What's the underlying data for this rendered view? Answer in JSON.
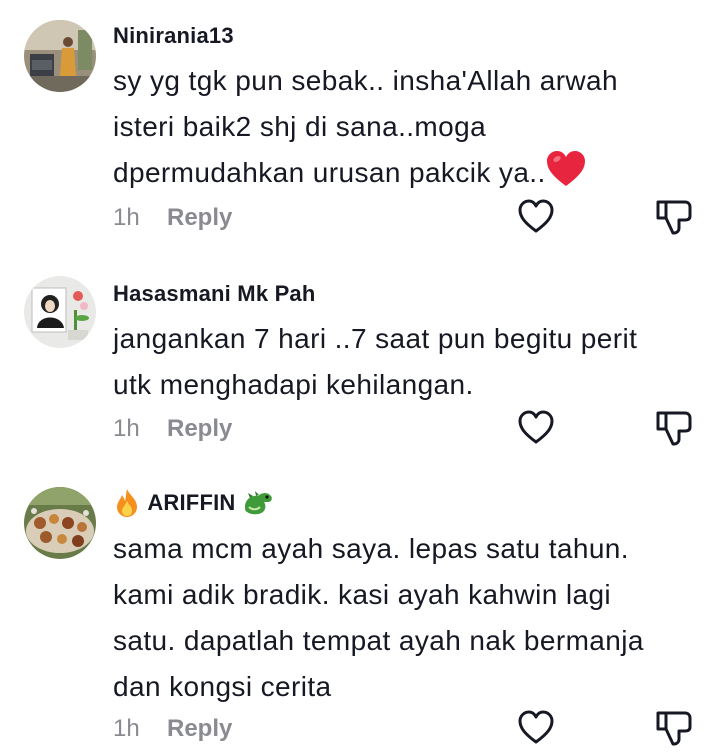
{
  "comments": [
    {
      "username": "Ninirania13",
      "text_lines": [
        "sy yg tgk pun sebak.. insha'Allah arwah",
        "isteri baik2 shj di sana..moga",
        "dpermudahkan urusan pakcik ya.."
      ],
      "time": "1h",
      "reply_label": "Reply",
      "text_emoji": "heart-emoji"
    },
    {
      "username": "Hasasmani Mk Pah",
      "text_lines": [
        "jangankan 7 hari ..7 saat pun begitu perit",
        "utk menghadapi kehilangan."
      ],
      "time": "1h",
      "reply_label": "Reply"
    },
    {
      "username": "ARIFFIN",
      "username_prefix_emoji": "fire-emoji",
      "username_suffix_emoji": "dragon-emoji",
      "text_lines": [
        "sama mcm ayah saya. lepas satu tahun.",
        "kami adik bradik. kasi ayah kahwin lagi",
        "satu. dapatlah tempat ayah nak bermanja",
        "dan kongsi cerita"
      ],
      "time": "1h",
      "reply_label": "Reply"
    }
  ],
  "icons": {
    "like": "heart-outline-icon",
    "dislike": "thumbs-down-outline-icon"
  },
  "colors": {
    "text": "#161823",
    "muted": "#8a8b91",
    "heart_emoji": "#e8253f"
  }
}
